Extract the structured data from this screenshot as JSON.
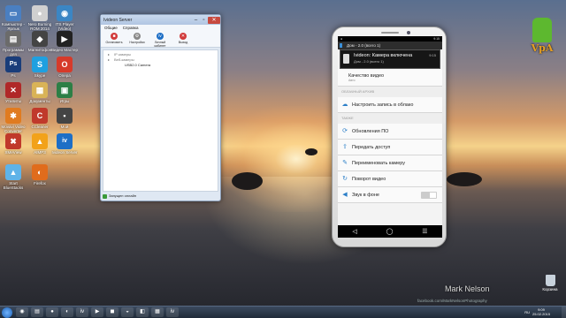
{
  "desktop": {
    "icons_left": [
      {
        "label": "Компьютер - Ярлык",
        "glyph": "▭",
        "color": "#4a7fc1"
      },
      {
        "label": "Nero Burning ROM 2014",
        "glyph": "●",
        "color": "#d0d0d0"
      },
      {
        "label": "ITS Player (Video)",
        "glyph": "◉",
        "color": "#3b86c4"
      },
      {
        "label": "Программы для скачивания",
        "glyph": "▤",
        "color": "#6b6b6b"
      },
      {
        "label": "Магнитофон",
        "glyph": "◆",
        "color": "#444"
      },
      {
        "label": "Видео Мастер",
        "glyph": "▶",
        "color": "#222"
      },
      {
        "label": "Ps",
        "glyph": "Ps",
        "color": "#1a3d7a"
      },
      {
        "label": "Skype",
        "glyph": "S",
        "color": "#1fa0e0"
      },
      {
        "label": "Опера",
        "glyph": "O",
        "color": "#d63a2a"
      },
      {
        "label": "Утилиты",
        "glyph": "✕",
        "color": "#b02828"
      },
      {
        "label": "Документы",
        "glyph": "▦",
        "color": "#d9b357"
      },
      {
        "label": "Игры",
        "glyph": "▣",
        "color": "#2d7f46"
      },
      {
        "label": "Movavi Video Converter",
        "glyph": "✱",
        "color": "#e07b20"
      },
      {
        "label": "CCleaner",
        "glyph": "C",
        "color": "#c0392b"
      },
      {
        "label": "Мой",
        "glyph": "▪",
        "color": "#444"
      },
      {
        "label": "XMeView",
        "glyph": "✖",
        "color": "#c0392b"
      },
      {
        "label": "AIMP3",
        "glyph": "▲",
        "color": "#f2a21a"
      },
      {
        "label": "Ivideon Server",
        "glyph": "iv",
        "color": "#1e6fc6"
      },
      {
        "label": "Start BlueStacks",
        "glyph": "▲",
        "color": "#5fb3e8"
      },
      {
        "label": "Firefox",
        "glyph": "◐",
        "color": "#e06c1c"
      }
    ],
    "recycle_label": "Корзина"
  },
  "window": {
    "title": "Ivideon Server",
    "menu": [
      "Общие",
      "Справка"
    ],
    "toolbar": [
      {
        "label": "Остановить",
        "glyph": "■",
        "color": "#d13b3b"
      },
      {
        "label": "Настройки",
        "glyph": "⚙",
        "color": "#888"
      },
      {
        "label": "Личный кабинет",
        "glyph": "iv",
        "color": "#1e6fc6"
      },
      {
        "label": "Выход",
        "glyph": "✕",
        "color": "#d13b3b"
      }
    ],
    "tree": [
      {
        "label": "IP камеры",
        "sub": false
      },
      {
        "label": "Веб-камеры",
        "sub": false
      },
      {
        "label": "USB2.0 Camera",
        "sub": true
      }
    ],
    "status": "Запущен онлайн"
  },
  "phone": {
    "statusbar_left": "●",
    "statusbar_right": "9:15",
    "notif_header": "Дом - 2.0 (всего 1)",
    "notification": {
      "title": "Ivideon: Камера включена",
      "subtitle": "Дом - 2.0 (всего 1)",
      "time": "9:15"
    },
    "quality": {
      "title": "Качество видео",
      "sub": "Авто"
    },
    "section_cloud": "ОБЛАЧНЫЙ АРХИВ",
    "cloud_item": "Настроить запись в облако",
    "section_other": "ТАКЖЕ",
    "items": [
      {
        "label": "Обновления ПО",
        "glyph": "⟳"
      },
      {
        "label": "Передать доступ",
        "glyph": "⇪"
      },
      {
        "label": "Переименовать камеру",
        "glyph": "✎"
      },
      {
        "label": "Поворот видео",
        "glyph": "↻"
      }
    ],
    "sound_label": "Звук в фоне",
    "nav": [
      "◁",
      "◯",
      "☰"
    ]
  },
  "watermark": {
    "author": "Mark Nelson",
    "link": "facebook.com/MarkNelsonPhotography"
  },
  "logo": {
    "text": "VpA"
  },
  "taskbar": {
    "apps": [
      "◉",
      "▤",
      "●",
      "◐",
      "iv",
      "▶",
      "◼",
      "◒",
      "◧",
      "▦",
      "iv"
    ],
    "lang": "RU",
    "time": "9:09",
    "date": "25.02.2015"
  }
}
